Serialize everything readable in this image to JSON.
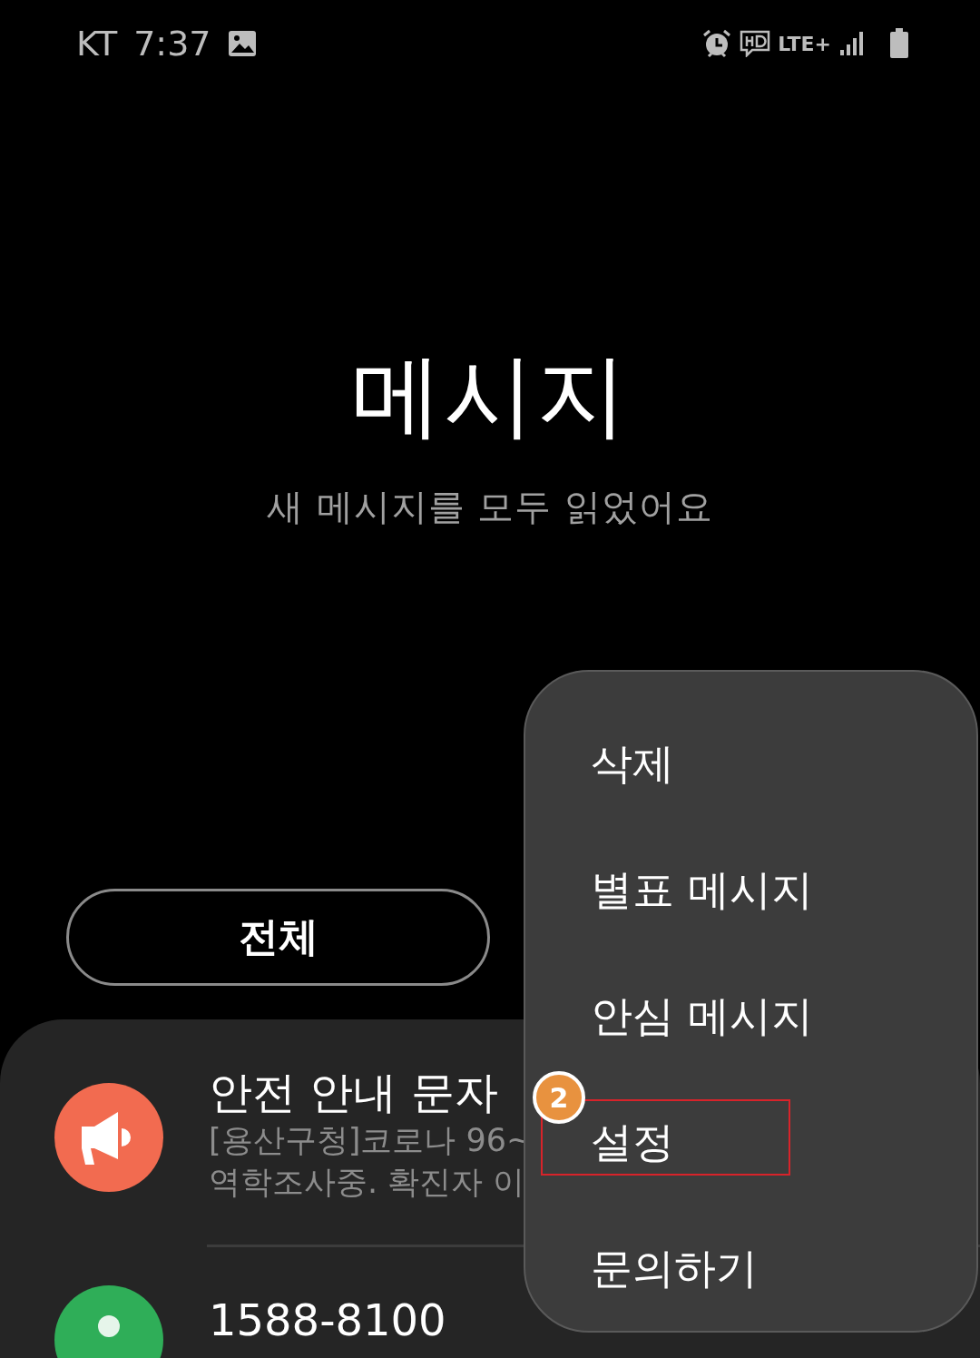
{
  "status_bar": {
    "carrier": "KT",
    "time": "7:37",
    "network": "LTE+"
  },
  "header": {
    "title": "메시지",
    "subtitle": "새 메시지를 모두 읽었어요"
  },
  "filter": {
    "label": "전체"
  },
  "conversations": [
    {
      "kind": "alert",
      "name": "안전 안내 문자",
      "preview": [
        "[용산구청]코로나 96~",
        "역학조사중. 확진자 이"
      ],
      "color": "#f26b50"
    },
    {
      "kind": "contact",
      "name": "1588-8100",
      "color": "#2fae58"
    }
  ],
  "menu": {
    "items": [
      {
        "label": "삭제",
        "highlighted": false
      },
      {
        "label": "별표 메시지",
        "highlighted": false
      },
      {
        "label": "안심 메시지",
        "highlighted": false
      },
      {
        "label": "설정",
        "highlighted": true
      },
      {
        "label": "문의하기",
        "highlighted": false
      }
    ]
  },
  "annotation": {
    "badge": "2"
  }
}
